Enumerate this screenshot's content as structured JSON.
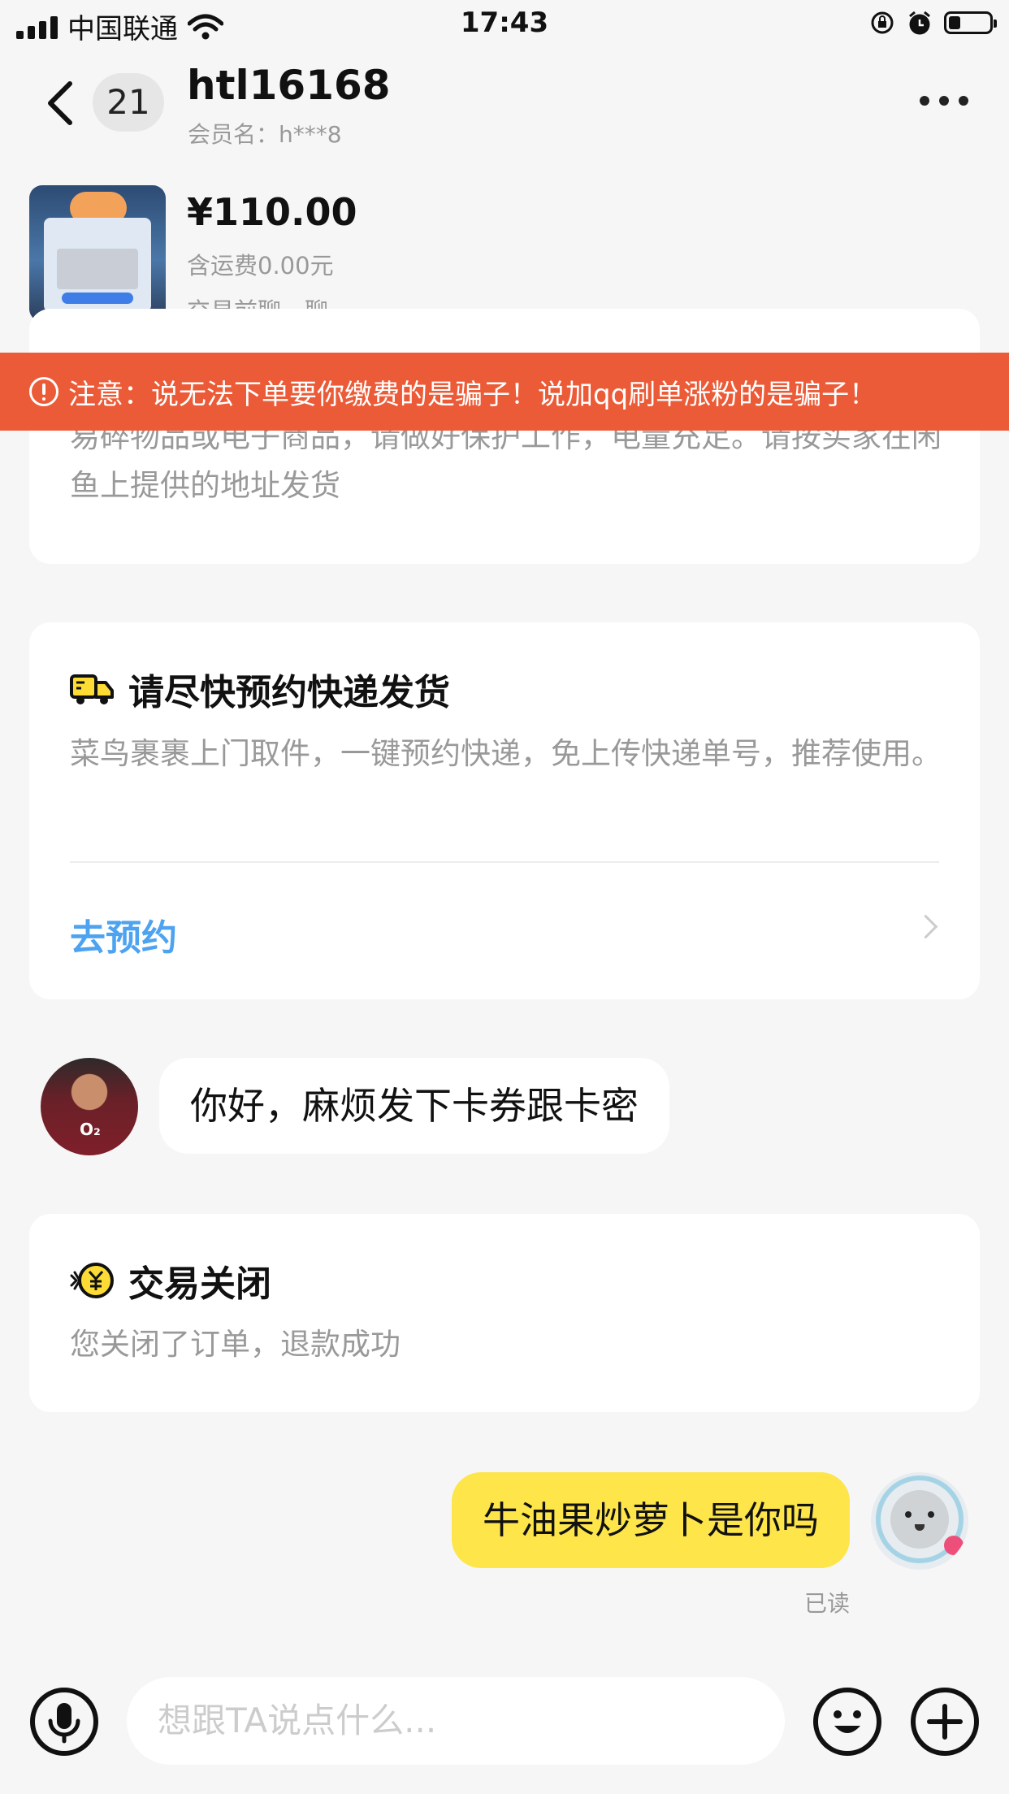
{
  "status_bar": {
    "carrier": "中国联通",
    "time": "17:43",
    "battery_level": 0.3,
    "icons": [
      "signal-icon",
      "wifi-icon",
      "rotation-lock-icon",
      "alarm-icon",
      "battery-icon"
    ]
  },
  "nav": {
    "unread_count": "21",
    "title": "htl16168",
    "member_label": "会员名：h***8"
  },
  "product": {
    "price": "¥110.00",
    "shipping": "含运费0.00元",
    "status": "交易前聊一聊"
  },
  "warning": {
    "text": "注意：说无法下单要你缴费的是骗子！说加qq刷单涨粉的是骗子！",
    "color": "#ec5b37"
  },
  "cards": {
    "shipping_tip": {
      "text": "易碎物品或电子商品，请做好保护工作，电量充足。请按买家在闲鱼上提供的地址发货"
    },
    "express": {
      "title": "请尽快预约快递发货",
      "desc": "菜鸟裹裹上门取件，一键预约快递，免上传快递单号，推荐使用。",
      "action": "去预约",
      "action_color": "#4da3f0"
    },
    "closed": {
      "title": "交易关闭",
      "desc": "您关闭了订单，退款成功"
    }
  },
  "messages": {
    "incoming": "你好，麻烦发下卡券跟卡密",
    "outgoing": "牛油果炒萝卜是你吗",
    "read_status": "已读",
    "bubble_color": "#fde54a"
  },
  "input": {
    "placeholder": "想跟TA说点什么..."
  }
}
